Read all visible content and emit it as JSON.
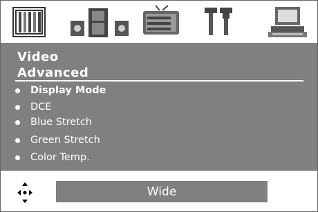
{
  "tabs": [
    {
      "icon": "video-stripes-icon"
    },
    {
      "icon": "audio-speakers-icon"
    },
    {
      "icon": "tv-icon"
    },
    {
      "icon": "tools-icon"
    },
    {
      "icon": "computer-icon"
    }
  ],
  "menu": {
    "title": "Video",
    "subtitle": "Advanced",
    "items": [
      {
        "label": "Display Mode",
        "selected": true
      },
      {
        "label": "DCE"
      },
      {
        "label": "Blue Stretch"
      },
      {
        "label": "Green Stretch"
      },
      {
        "label": "Color Temp."
      }
    ]
  },
  "footer": {
    "nav_icon": "four-way-arrows-icon",
    "value": "Wide"
  },
  "colors": {
    "panel": "#808080",
    "text": "#ffffff",
    "icon": "#404040"
  }
}
